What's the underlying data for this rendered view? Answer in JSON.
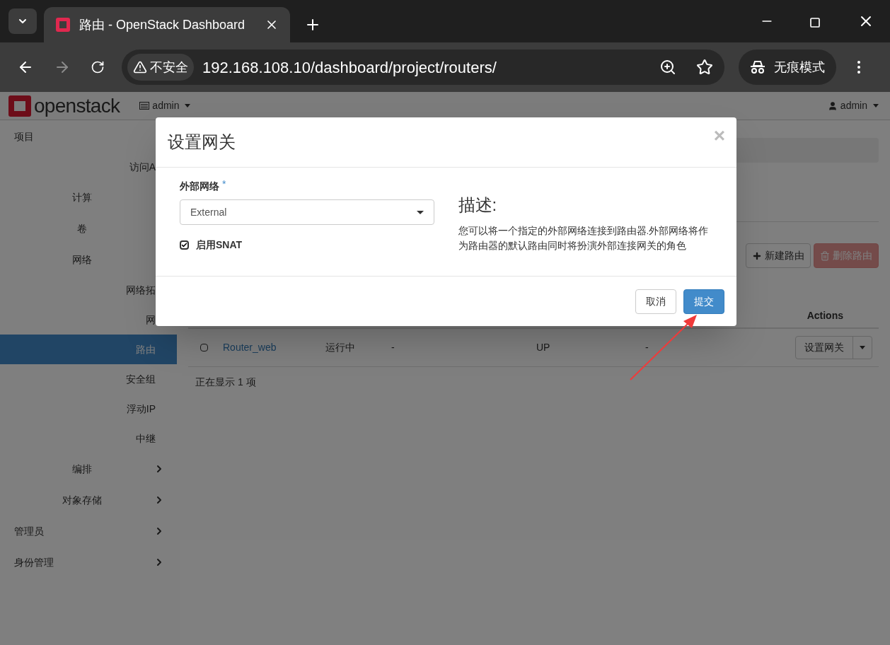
{
  "browser": {
    "tab_title": "路由 - OpenStack Dashboard",
    "security_label": "不安全",
    "url": "192.168.108.10/dashboard/project/routers/",
    "incognito_label": "无痕模式"
  },
  "header": {
    "logo_text": "openstack",
    "project": "admin",
    "user": "admin"
  },
  "sidebar": {
    "items": [
      {
        "label": "项目",
        "kind": "section",
        "children": [
          {
            "label": "访问A",
            "kind": "leaf",
            "selected": false
          },
          {
            "label": "计算",
            "kind": "group"
          },
          {
            "label": "卷",
            "kind": "group"
          },
          {
            "label": "网络",
            "kind": "group",
            "children": [
              {
                "label": "网络拓",
                "kind": "leaf",
                "selected": false
              },
              {
                "label": "网",
                "kind": "leaf",
                "selected": false
              },
              {
                "label": "路由",
                "kind": "leaf",
                "selected": true
              },
              {
                "label": "安全组",
                "kind": "leaf",
                "selected": false
              },
              {
                "label": "浮动IP",
                "kind": "leaf",
                "selected": false
              },
              {
                "label": "中继",
                "kind": "leaf",
                "selected": false
              }
            ]
          },
          {
            "label": "编排",
            "kind": "group",
            "expanded": false
          },
          {
            "label": "对象存储",
            "kind": "group",
            "expanded": false
          }
        ]
      },
      {
        "label": "管理员",
        "kind": "section",
        "expanded": false
      },
      {
        "label": "身份管理",
        "kind": "section",
        "expanded": false
      }
    ]
  },
  "toolbar": {
    "buttons": [
      {
        "label": "新建路由",
        "kind": "create",
        "disabled": false
      },
      {
        "label": "删除路由",
        "kind": "delete",
        "disabled": true
      }
    ]
  },
  "table": {
    "header": "Actions",
    "rows": [
      {
        "checked": false,
        "name": "Router_web",
        "status": "运行中",
        "column_4": "-",
        "admin_state": "UP",
        "column_6": "-",
        "action": "设置网关"
      }
    ],
    "footer": "正在显示 1 项"
  },
  "modal": {
    "title": "设置网关",
    "close": "×",
    "field_label": "外部网络",
    "required_mark": "*",
    "select_value": "External",
    "snat": {
      "label": "启用SNAT",
      "checked": true
    },
    "description_title": "描述:",
    "description": "您可以将一个指定的外部网络连接到路由器.外部网络将作为路由器的默认路由同时将扮演外部连接网关的角色",
    "buttons": [
      {
        "label": "取消",
        "kind": "default"
      },
      {
        "label": "提交",
        "kind": "primary"
      }
    ]
  }
}
